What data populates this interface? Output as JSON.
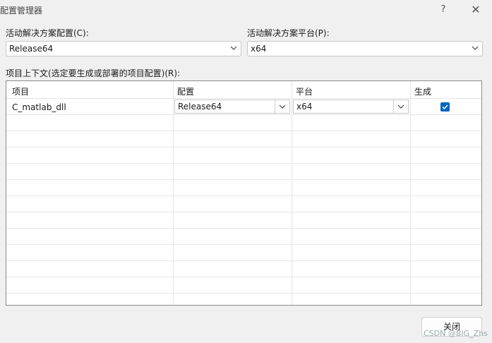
{
  "window": {
    "title": "配置管理器",
    "help_glyph": "?",
    "close_glyph": "✕"
  },
  "solution": {
    "config_label": "活动解决方案配置(C):",
    "config_value": "Release64",
    "platform_label": "活动解决方案平台(P):",
    "platform_value": "x64"
  },
  "context_label": "项目上下文(选定要生成或部署的项目配置)(R):",
  "table": {
    "headers": [
      "项目",
      "配置",
      "平台",
      "生成"
    ],
    "rows": [
      {
        "project": "C_matlab_dll",
        "config": "Release64",
        "platform": "x64",
        "build": true
      }
    ]
  },
  "buttons": {
    "close": "关闭"
  },
  "watermark": "CSDN @BIG_Zhs",
  "colors": {
    "accent": "#0067c0"
  },
  "icons": [
    "chevron-down-icon",
    "checkbox-checked-icon",
    "help-icon",
    "close-icon"
  ]
}
